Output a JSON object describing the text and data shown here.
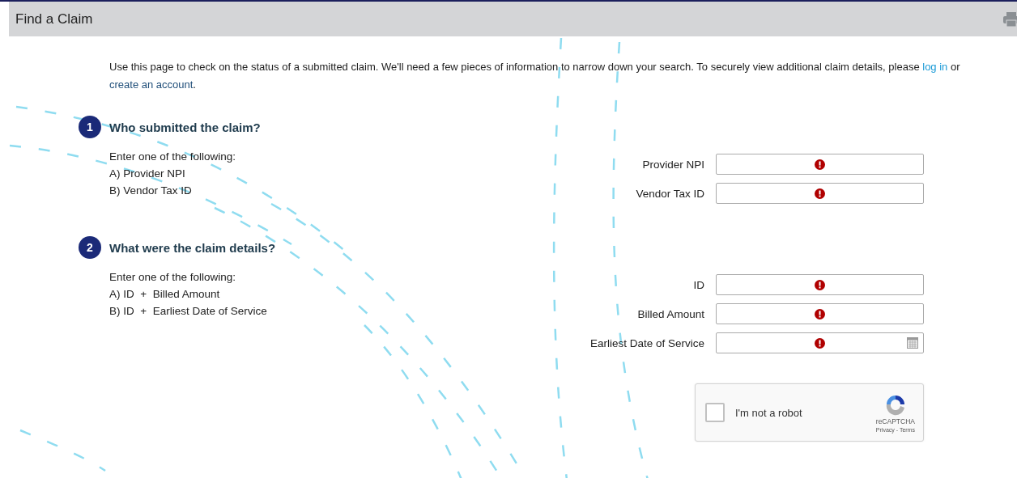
{
  "header": {
    "title": "Find a Claim"
  },
  "intro": [
    {
      "kind": "text",
      "text": "Use this page to check on the status of a submitted claim. We'll need a few pieces of information to narrow down your search. To securely view additional claim details, please "
    },
    {
      "kind": "link",
      "text": "log in",
      "color": "#1a9ad6"
    },
    {
      "kind": "text",
      "text": " or "
    },
    {
      "kind": "link",
      "text": "create an account",
      "color": "#1f4e79"
    },
    {
      "kind": "text",
      "text": "."
    }
  ],
  "steps": [
    {
      "number": "1",
      "title": "Who submitted the claim?",
      "lines": [
        "Enter one of the following:",
        "A) Provider NPI",
        "B) Vendor Tax ID"
      ],
      "fields": [
        {
          "label": "Provider NPI",
          "kind": "text",
          "error": true
        },
        {
          "label": "Vendor Tax ID",
          "kind": "text",
          "error": true
        }
      ]
    },
    {
      "number": "2",
      "title": "What were the claim details?",
      "lines": [
        "Enter one of the following:",
        "A) ID  +  Billed Amount",
        "B) ID  +  Earliest Date of Service"
      ],
      "fields": [
        {
          "label": "ID",
          "kind": "text",
          "error": true
        },
        {
          "label": "Billed Amount",
          "kind": "text",
          "error": true
        },
        {
          "label": "Earliest Date of Service",
          "kind": "date",
          "error": true
        }
      ]
    }
  ],
  "captcha": {
    "label": "I'm not a robot",
    "checked": false,
    "brand": "reCAPTCHA",
    "links": "Privacy - Terms"
  }
}
